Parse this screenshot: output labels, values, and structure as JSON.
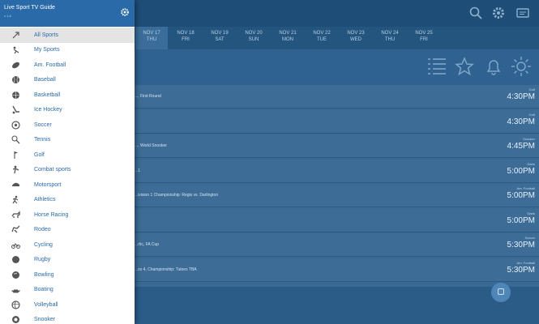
{
  "drawer": {
    "app_title": "Live Sport TV Guide",
    "version": "v 1.6",
    "items": [
      {
        "label": "All Sports",
        "icon": "all-sports-icon",
        "active": true
      },
      {
        "label": "My Sports",
        "icon": "my-sports-icon"
      },
      {
        "label": "Am. Football",
        "icon": "american-football-icon"
      },
      {
        "label": "Baseball",
        "icon": "baseball-icon"
      },
      {
        "label": "Basketball",
        "icon": "basketball-icon"
      },
      {
        "label": "Ice Hockey",
        "icon": "ice-hockey-icon"
      },
      {
        "label": "Soccer",
        "icon": "soccer-icon"
      },
      {
        "label": "Tennis",
        "icon": "tennis-icon"
      },
      {
        "label": "Golf",
        "icon": "golf-icon"
      },
      {
        "label": "Combat sports",
        "icon": "combat-sports-icon"
      },
      {
        "label": "Motorsport",
        "icon": "motorsport-icon"
      },
      {
        "label": "Athletics",
        "icon": "athletics-icon"
      },
      {
        "label": "Horse Racing",
        "icon": "horse-racing-icon"
      },
      {
        "label": "Rodeo",
        "icon": "rodeo-icon"
      },
      {
        "label": "Cycling",
        "icon": "cycling-icon"
      },
      {
        "label": "Rugby",
        "icon": "rugby-icon"
      },
      {
        "label": "Bowling",
        "icon": "bowling-icon"
      },
      {
        "label": "Boating",
        "icon": "boating-icon"
      },
      {
        "label": "Volleyball",
        "icon": "volleyball-icon"
      },
      {
        "label": "Snooker",
        "icon": "snooker-icon"
      }
    ]
  },
  "dates": [
    {
      "day": "NOV 17",
      "weekday": "THU",
      "active": true
    },
    {
      "day": "NOV 18",
      "weekday": "FRI"
    },
    {
      "day": "NOV 19",
      "weekday": "SAT"
    },
    {
      "day": "NOV 20",
      "weekday": "SUN"
    },
    {
      "day": "NOV 21",
      "weekday": "MON"
    },
    {
      "day": "NOV 22",
      "weekday": "TUE"
    },
    {
      "day": "NOV 23",
      "weekday": "WED"
    },
    {
      "day": "NOV 24",
      "weekday": "THU"
    },
    {
      "day": "NOV 25",
      "weekday": "FRI"
    }
  ],
  "events": [
    {
      "title": "..., First Round",
      "sport": "Golf",
      "time": "4:30PM"
    },
    {
      "title": "",
      "sport": "Golf",
      "time": "4:30PM"
    },
    {
      "title": "..., World Snooker",
      "sport": "Snooker",
      "time": "4:45PM"
    },
    {
      "title": "...1",
      "sport": "Darts",
      "time": "5:00PM"
    },
    {
      "title": "...ivision 1 Championship: Regis vs. Darlington",
      "sport": "Am. Football",
      "time": "5:00PM"
    },
    {
      "title": "",
      "sport": "Darts",
      "time": "5:00PM"
    },
    {
      "title": "...rtic, FA Cup",
      "sport": "Soccer",
      "time": "5:30PM"
    },
    {
      "title": "...ss 4, Championship: Tuloes TBA",
      "sport": "Am. Football",
      "time": "5:30PM"
    }
  ],
  "colors": {
    "header_blue": "#2a6aa8",
    "accent_text": "#2a6aa8",
    "active_item_bg": "#e4e4e4"
  }
}
